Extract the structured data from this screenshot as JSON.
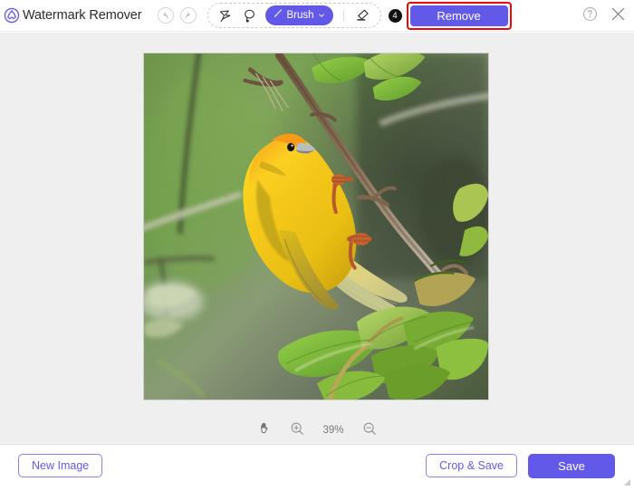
{
  "app": {
    "title": "Watermark Remover",
    "logo_icon": "droplet-wave-logo-icon",
    "accent_color": "#6359e9",
    "highlight_color": "#ef0606"
  },
  "toolbar": {
    "undo_icon": "undo-arrow-icon",
    "redo_icon": "redo-arrow-icon",
    "polygon_lasso_icon": "polygon-lasso-icon",
    "lasso_icon": "lasso-icon",
    "brush": {
      "icon": "brush-icon",
      "label": "Brush",
      "chevron_icon": "chevron-down-icon"
    },
    "eraser_icon": "eraser-icon",
    "step_badge": "4",
    "remove_label": "Remove",
    "help_icon": "question-circle-icon",
    "close_icon": "close-x-icon"
  },
  "zoombar": {
    "hand_icon": "hand-pan-icon",
    "zoom_in_icon": "zoom-in-icon",
    "zoom_level": "39%",
    "zoom_out_icon": "zoom-out-icon"
  },
  "footer": {
    "new_image_label": "New Image",
    "crop_save_label": "Crop & Save",
    "save_label": "Save"
  },
  "canvas": {
    "photo_alt": "Yellow weaver bird perched on a branch with green leaves"
  }
}
